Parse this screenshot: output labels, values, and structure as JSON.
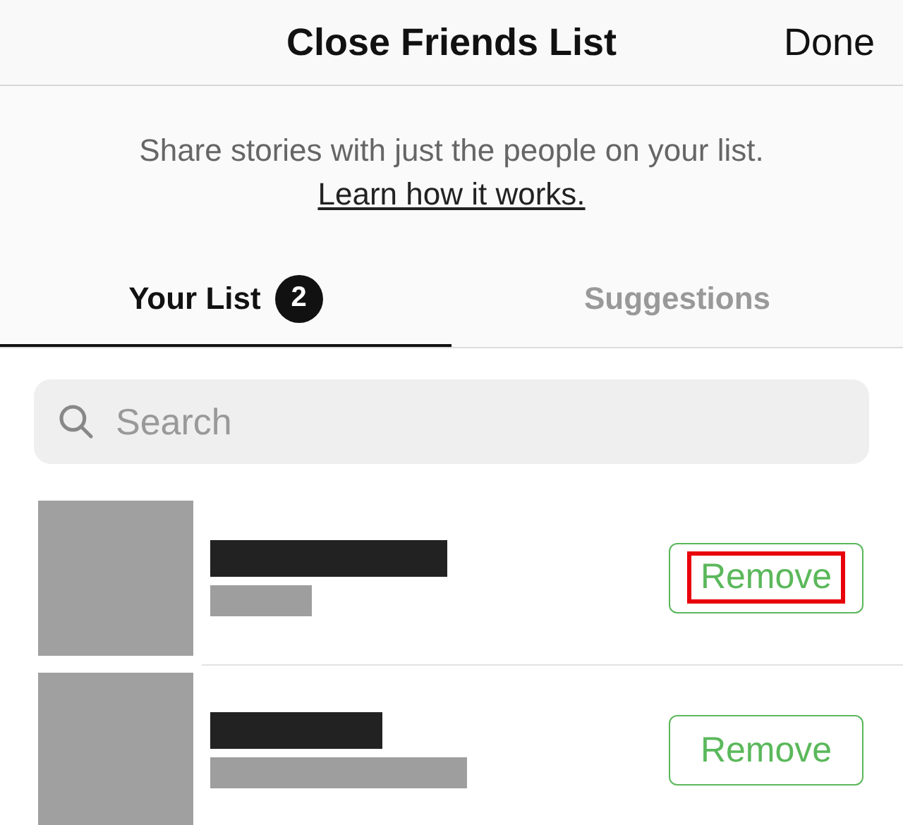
{
  "header": {
    "title": "Close Friends List",
    "done": "Done"
  },
  "intro": {
    "text": "Share stories with just the people on your list.",
    "link": "Learn how it works."
  },
  "tabs": [
    {
      "label": "Your List",
      "badge": "2",
      "selected": true
    },
    {
      "label": "Suggestions",
      "selected": false
    }
  ],
  "search": {
    "placeholder": "Search"
  },
  "people": [
    {
      "action": "Remove",
      "highlighted": true
    },
    {
      "action": "Remove",
      "highlighted": false
    }
  ]
}
